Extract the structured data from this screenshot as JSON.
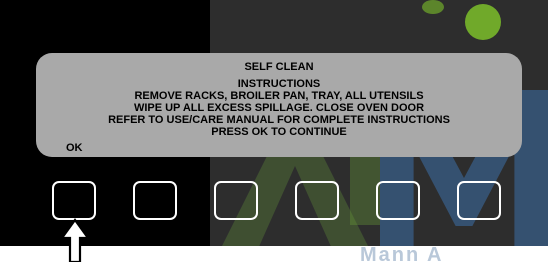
{
  "dialog": {
    "title": "SELF CLEAN",
    "subtitle": "INSTRUCTIONS",
    "lines": [
      "REMOVE RACKS, BROILER PAN, TRAY, ALL UTENSILS",
      "WIPE UP ALL EXCESS SPILLAGE. CLOSE OVEN DOOR",
      "REFER TO USE/CARE MANUAL FOR COMPLETE INSTRUCTIONS",
      "PRESS OK TO CONTINUE"
    ],
    "ok_label": "OK"
  },
  "softkeys": [
    "",
    "",
    "",
    "",
    "",
    ""
  ],
  "watermark": {
    "text": "Mann A"
  },
  "colors": {
    "screen": "#000000",
    "dialog": "#a9a9a9",
    "key_border": "#ffffff"
  },
  "icons": {
    "pointer": "up-arrow-icon"
  }
}
